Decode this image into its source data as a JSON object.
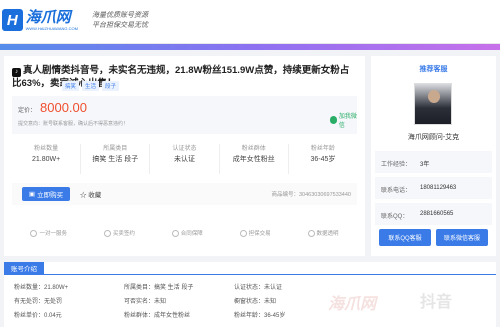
{
  "site": {
    "logo_mark": "H",
    "logo_title": "海爪网",
    "logo_sub": "WWW.HAIZHUAWANG.COM",
    "slogan_line1": "海量优质账号资源",
    "slogan_line2": "平台担保交易无忧"
  },
  "listing": {
    "platform_badge": "♪",
    "title": "真人剧情类抖音号，未实名无违规，21.8W粉丝151.9W点赞，持续更新女粉占比63%，卖家诚心出售！",
    "tags": [
      "搞笑",
      "生活",
      "段子"
    ],
    "price_label": "定价：",
    "price": "8000.00",
    "price_note": "提交意向：账号联系客服，确认后不得恶意违约！",
    "wechat_label": "加我微信",
    "stats": [
      {
        "label": "粉丝数量",
        "value": "21.80W+"
      },
      {
        "label": "所属类目",
        "value": "搞笑 生活 段子"
      },
      {
        "label": "认证状态",
        "value": "未认证"
      },
      {
        "label": "粉丝群体",
        "value": "成年女性粉丝"
      },
      {
        "label": "粉丝年龄",
        "value": "36-45岁"
      }
    ],
    "buy_label": "立即购买",
    "collect_label": "☆ 收藏",
    "product_no": "商品编号：30463030697533440",
    "features": [
      "一对一服务",
      "买卖签约",
      "合同保障",
      "担保交易",
      "数据透明"
    ]
  },
  "advisor": {
    "header": "推荐客服",
    "name": "海爪网顾问-艾克",
    "rows": [
      {
        "key": "工作经验：",
        "value": "3年"
      },
      {
        "key": "联系电话：",
        "value": "18081129463"
      },
      {
        "key": "联系QQ：",
        "value": "2881660565"
      }
    ],
    "qq_button": "联系QQ客服",
    "wx_button": "联系微信客服"
  },
  "intro": {
    "tab": "账号介绍",
    "items": [
      "粉丝数量：21.80W+",
      "所属类目：搞笑 生活 段子",
      "认证状态：未认证",
      "",
      "有无处罚：无处罚",
      "可否实名：未知",
      "橱窗状态：未知",
      "",
      "粉丝单价：0.04元",
      "粉丝群体：成年女性粉丝",
      "粉丝年龄：36-45岁",
      ""
    ]
  },
  "watermark": {
    "left": "海爪网",
    "right": "抖音"
  }
}
